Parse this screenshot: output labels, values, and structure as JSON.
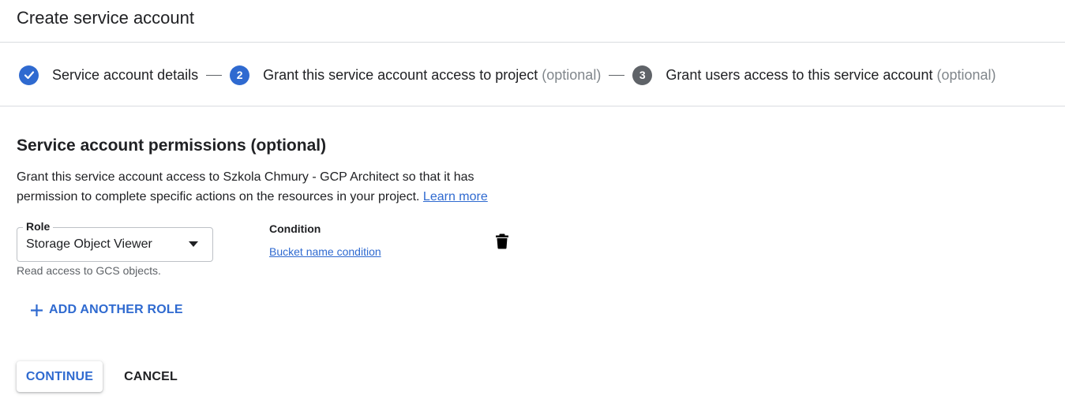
{
  "header": {
    "title": "Create service account"
  },
  "stepper": {
    "steps": [
      {
        "label": "Service account details",
        "optional": "",
        "state": "done"
      },
      {
        "number": "2",
        "label": "Grant this service account access to project",
        "optional": "(optional)",
        "state": "active"
      },
      {
        "number": "3",
        "label": "Grant users access to this service account",
        "optional": "(optional)",
        "state": "todo"
      }
    ]
  },
  "section": {
    "title": "Service account permissions (optional)",
    "description": "Grant this service account access to Szkola Chmury - GCP Architect so that it has permission to complete specific actions on the resources in your project.",
    "learn_more": "Learn more"
  },
  "role": {
    "label": "Role",
    "value": "Storage Object Viewer",
    "hint": "Read access to GCS objects."
  },
  "condition": {
    "heading": "Condition",
    "link": "Bucket name condition"
  },
  "add_role_label": "ADD ANOTHER ROLE",
  "buttons": {
    "continue": "CONTINUE",
    "cancel": "CANCEL"
  },
  "icons": {
    "check": "check-icon",
    "delete": "trash-icon",
    "dropdown": "caret-down-icon",
    "add": "plus-icon"
  },
  "colors": {
    "accent": "#2f6ad0",
    "step_inactive": "#5f6368",
    "divider": "#dadce0"
  }
}
